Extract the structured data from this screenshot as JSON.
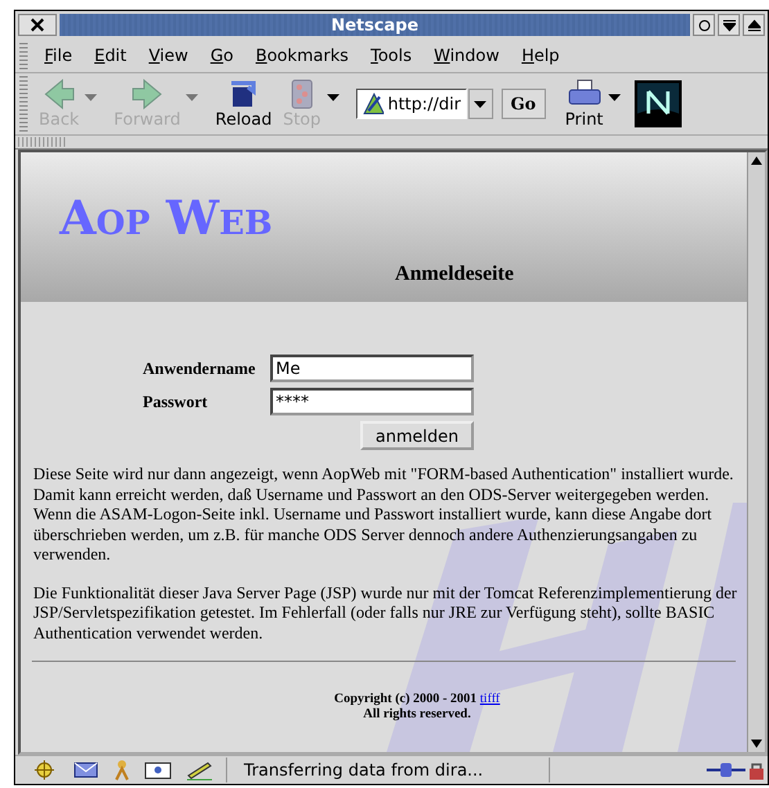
{
  "window": {
    "title": "Netscape"
  },
  "menu": [
    {
      "label": "File"
    },
    {
      "label": "Edit"
    },
    {
      "label": "View"
    },
    {
      "label": "Go"
    },
    {
      "label": "Bookmarks"
    },
    {
      "label": "Tools"
    },
    {
      "label": "Window"
    },
    {
      "label": "Help"
    }
  ],
  "toolbar": [
    {
      "kind": "back",
      "label": "Back",
      "disabled": true
    },
    {
      "kind": "forward",
      "label": "Forward",
      "disabled": true
    },
    {
      "kind": "reload",
      "label": "Reload",
      "disabled": false
    },
    {
      "kind": "stop",
      "label": "Stop",
      "disabled": true
    }
  ],
  "address": {
    "value": "http://dir",
    "go": "Go"
  },
  "print": {
    "label": "Print"
  },
  "page": {
    "logo": "AOP WEB",
    "heading": "Anmeldeseite",
    "form": {
      "fields": [
        {
          "label": "Anwendername",
          "value": "Me"
        },
        {
          "label": "Passwort",
          "value": "****"
        }
      ],
      "button": "anmelden"
    },
    "paragraphs": [
      "Diese Seite wird nur dann angezeigt, wenn AopWeb mit \"FORM-based Authentication\" installiert wurde. Damit kann erreicht werden, daß Username und Passwort an den ODS-Server weitergegeben werden. Wenn die ASAM-Logon-Seite inkl. Username und Passwort installiert wurde, kann diese Angabe dort überschrieben werden, um z.B. für manche ODS Server dennoch andere Authenzierungsangaben zu verwenden.",
      "Die Funktionalität dieser Java Server Page (JSP) wurde nur mit der Tomcat Referenzimplementierung der JSP/Servletspezifikation getestet. Im Fehlerfall (oder falls nur JRE zur Verfügung steht), sollte BASIC Authentication verwendet werden."
    ],
    "copyright": {
      "text": "Copyright (c) 2000 - 2001",
      "link": "tifff"
    },
    "rights": "All rights reserved."
  },
  "status_bar": {
    "text": "Transferring data from dira..."
  }
}
